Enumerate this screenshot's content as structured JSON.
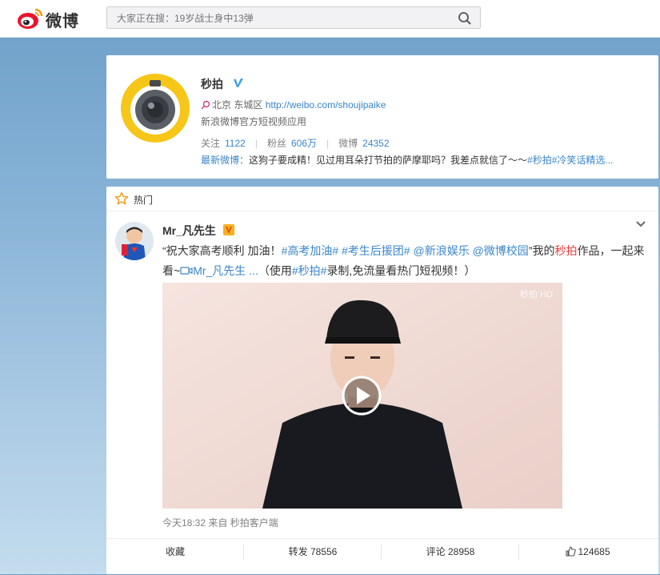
{
  "header": {
    "logo_text": "微博",
    "search_placeholder": "大家正在搜：19岁战士身中13弹"
  },
  "profile": {
    "name": "秒拍",
    "location": "北京 东城区",
    "url": "http://weibo.com/shoujipaike",
    "description": "新浪微博官方短视频应用",
    "stats": [
      {
        "label": "关注",
        "value": "1122"
      },
      {
        "label": "粉丝",
        "value": "606万"
      },
      {
        "label": "微博",
        "value": "24352"
      }
    ],
    "latest_label": "最新微博：",
    "latest_text": "这狗子要成精！见过用耳朵打节拍的萨摩耶吗？我差点就信了～～",
    "latest_tags": "#秒拍#冷笑话精选..."
  },
  "feed": {
    "section_title": "热门",
    "post": {
      "author": "Mr_凡先生",
      "text_parts": {
        "p1": "“祝大家高考顺利 加油！",
        "tags": "#高考加油# #考生后援团# @新浪娱乐 @微博校园",
        "p2": "”我的",
        "miaopai": "秒拍",
        "p3": "作品，一起来看~",
        "video_link": "Mr_凡先生 ...",
        "p4": "（使用",
        "tag2": "#秒拍#",
        "p5": "录制,免流量看热门短视频！）"
      },
      "watermark": "秒拍 HD",
      "meta": "今天18:32 来自 秒拍客户端",
      "actions": {
        "collect": "收藏",
        "forward": "转发 78556",
        "comment": "评论 28958",
        "like": "124685"
      }
    }
  },
  "colors": {
    "link_blue": "#3a86c8",
    "accent_orange": "#eb7350",
    "brand_yellow": "#f6c618"
  }
}
